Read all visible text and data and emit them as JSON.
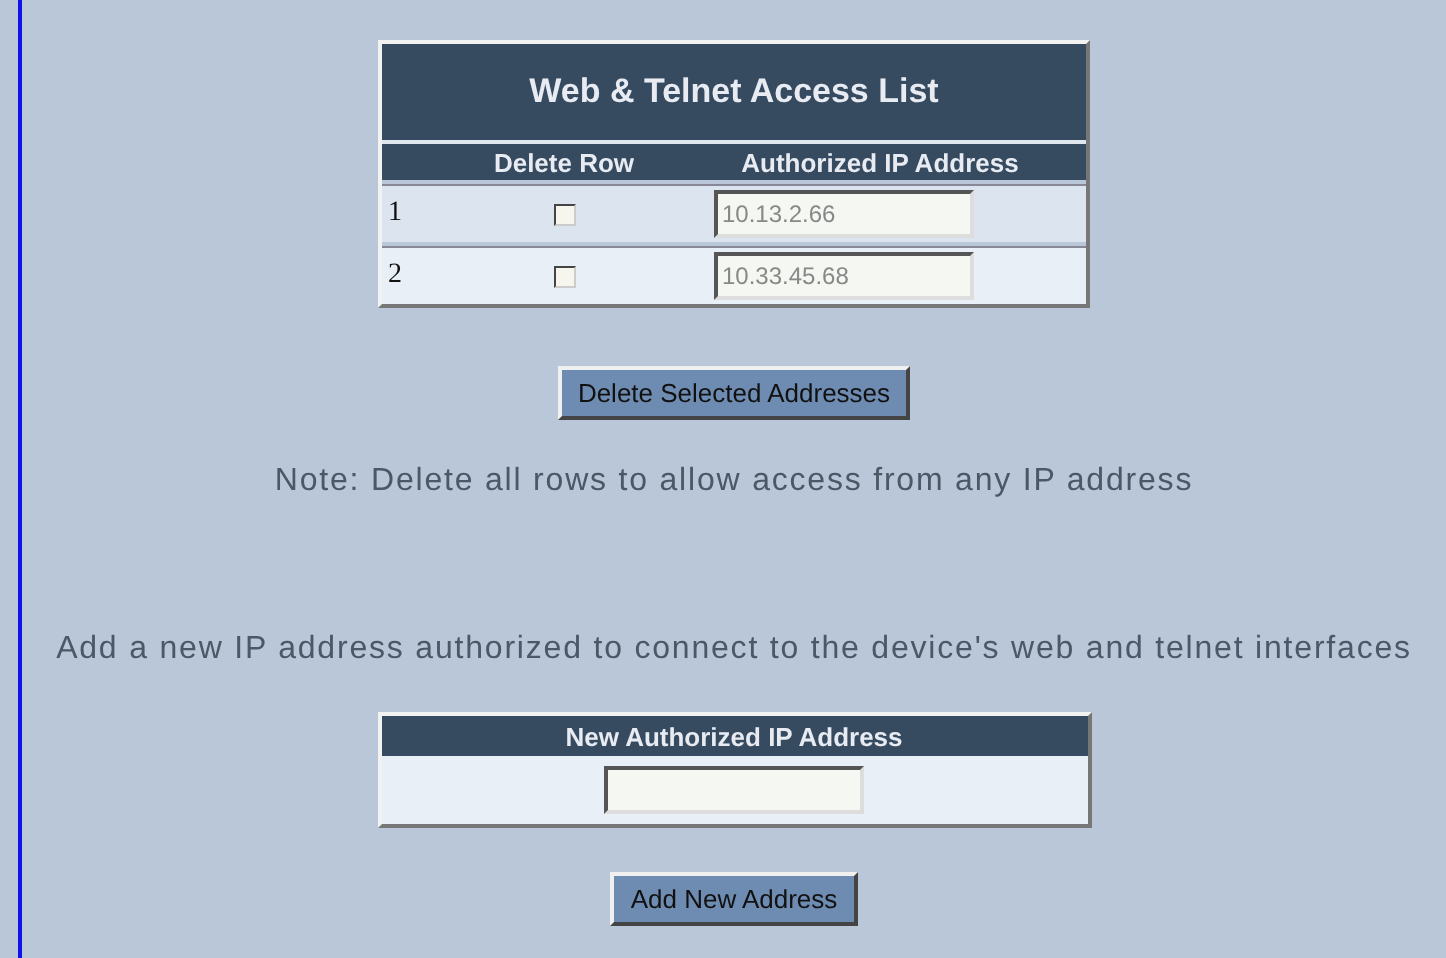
{
  "access_list": {
    "title": "Web & Telnet Access List",
    "columns": [
      "Delete Row",
      "Authorized IP Address"
    ],
    "rows": [
      {
        "index": "1",
        "checked": false,
        "ip": "10.13.2.66"
      },
      {
        "index": "2",
        "checked": false,
        "ip": "10.33.45.68"
      }
    ]
  },
  "delete_button": "Delete Selected Addresses",
  "note": "Note: Delete all rows to allow access from any IP address",
  "add_text": "Add a new IP address authorized to connect to the device's web and telnet interfaces",
  "new_address": {
    "header": "New Authorized IP Address"
  },
  "add_button": "Add New Address"
}
